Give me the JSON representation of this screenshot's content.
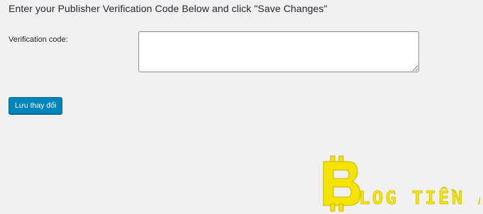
{
  "page": {
    "heading": "Enter your Publisher Verification Code Below and click \"Save Changes\""
  },
  "form": {
    "verification_label": "Verification code:",
    "verification_value": "",
    "save_label": "Lưu thay đổi"
  },
  "watermark": {
    "text": "BLOG TIỀN ẢO",
    "color": "#f5e400"
  },
  "colors": {
    "background": "#f1f1f1",
    "button": "#0085ba",
    "button_border": "#006799"
  }
}
